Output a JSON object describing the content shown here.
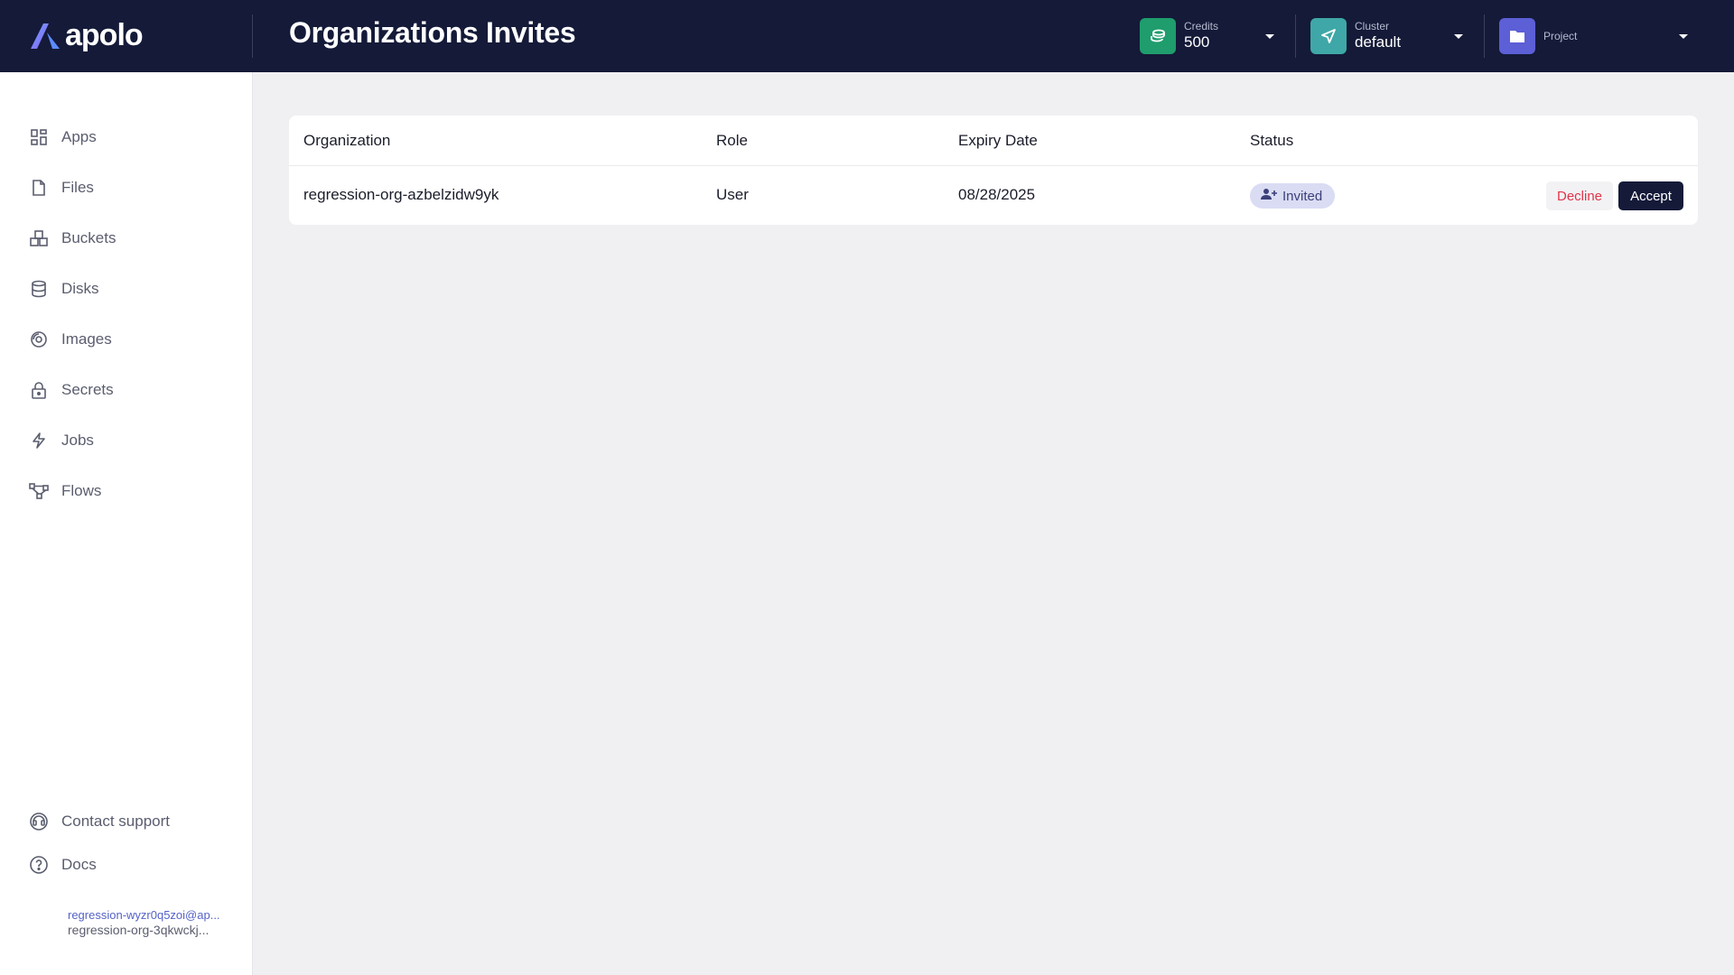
{
  "app": {
    "logo_text": "apolo"
  },
  "header": {
    "title": "Organizations Invites",
    "credits": {
      "label": "Credits",
      "value": "500",
      "icon": "coins-icon",
      "color": "#1f9d6d"
    },
    "cluster": {
      "label": "Cluster",
      "value": "default",
      "icon": "send-icon",
      "color": "#3fa7a7"
    },
    "project": {
      "label": "Project",
      "value": "",
      "icon": "folder-icon",
      "color": "#5c5fd6"
    }
  },
  "sidebar": {
    "items": [
      {
        "label": "Apps",
        "icon": "apps-grid-icon"
      },
      {
        "label": "Files",
        "icon": "file-icon"
      },
      {
        "label": "Buckets",
        "icon": "buckets-icon"
      },
      {
        "label": "Disks",
        "icon": "database-icon"
      },
      {
        "label": "Images",
        "icon": "disc-icon"
      },
      {
        "label": "Secrets",
        "icon": "lock-icon"
      },
      {
        "label": "Jobs",
        "icon": "lightning-icon"
      },
      {
        "label": "Flows",
        "icon": "flow-icon"
      }
    ],
    "footer": [
      {
        "label": "Contact support",
        "icon": "headset-icon"
      },
      {
        "label": "Docs",
        "icon": "help-circle-icon"
      }
    ],
    "user": {
      "email": "regression-wyzr0q5zoi@ap...",
      "org": "regression-org-3qkwckj..."
    }
  },
  "invites": {
    "columns": [
      "Organization",
      "Role",
      "Expiry Date",
      "Status"
    ],
    "rows": [
      {
        "organization": "regression-org-azbelzidw9yk",
        "role": "User",
        "expiry": "08/28/2025",
        "status": "Invited",
        "decline_label": "Decline",
        "accept_label": "Accept"
      }
    ]
  },
  "colors": {
    "header_bg": "#141a38",
    "accent": "#5562c8",
    "danger": "#e0344a"
  }
}
